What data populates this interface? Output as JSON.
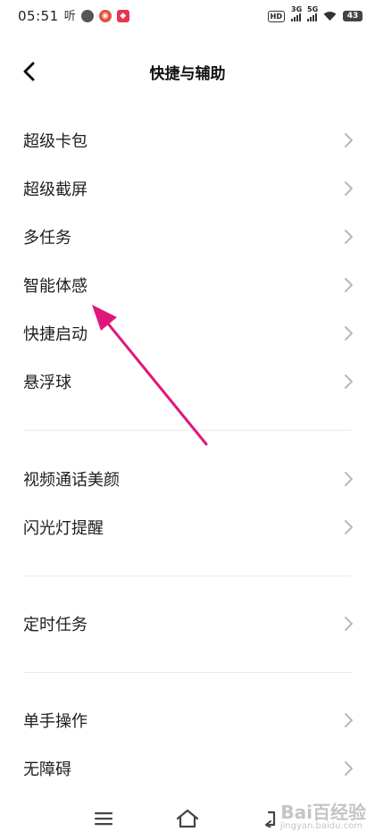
{
  "status_bar": {
    "time": "05:51",
    "app_glyph_1": "听",
    "hd_label": "HD",
    "signal_1_label": "3G",
    "signal_2_label": "5G",
    "battery_level": "43"
  },
  "header": {
    "title": "快捷与辅助"
  },
  "sections": [
    {
      "items": [
        {
          "label": "超级卡包"
        },
        {
          "label": "超级截屏"
        },
        {
          "label": "多任务"
        },
        {
          "label": "智能体感"
        },
        {
          "label": "快捷启动"
        },
        {
          "label": "悬浮球"
        }
      ]
    },
    {
      "items": [
        {
          "label": "视频通话美颜"
        },
        {
          "label": "闪光灯提醒"
        }
      ]
    },
    {
      "items": [
        {
          "label": "定时任务"
        }
      ]
    },
    {
      "items": [
        {
          "label": "单手操作"
        },
        {
          "label": "无障碍"
        }
      ]
    }
  ],
  "watermark": {
    "text": "Bai百经验",
    "sub": "jingyan.baidu.com"
  },
  "colors": {
    "annotation_arrow": "#e0177a",
    "chevron": "#b8b8b8",
    "divider": "#ececec"
  }
}
